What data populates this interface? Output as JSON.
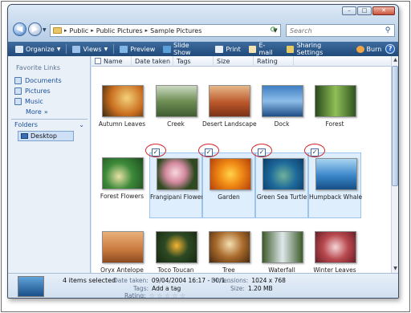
{
  "window": {
    "controls": {
      "minimize": "–",
      "maximize": "□",
      "close": "✕"
    }
  },
  "address": {
    "segments": [
      "Public",
      "Public Pictures",
      "Sample Pictures"
    ]
  },
  "search": {
    "placeholder": "Search"
  },
  "toolbar": {
    "organize": "Organize",
    "views": "Views",
    "preview": "Preview",
    "slideshow": "Slide Show",
    "print": "Print",
    "email": "E-mail",
    "sharing": "Sharing Settings",
    "burn": "Burn",
    "help": "?"
  },
  "nav": {
    "favorites_title": "Favorite Links",
    "favorites": [
      "Documents",
      "Pictures",
      "Music"
    ],
    "more": "More",
    "more_glyph": "»",
    "folders": "Folders",
    "desktop": "Desktop"
  },
  "columns": [
    "Name",
    "Date taken",
    "Tags",
    "Size",
    "Rating"
  ],
  "checkmark": "✓",
  "items": [
    {
      "name": "Autumn Leaves",
      "selected": false
    },
    {
      "name": "Creek",
      "selected": false
    },
    {
      "name": "Desert Landscape",
      "selected": false
    },
    {
      "name": "Dock",
      "selected": false
    },
    {
      "name": "Forest",
      "selected": false
    },
    {
      "name": "Forest Flowers",
      "selected": false
    },
    {
      "name": "Frangipani Flowers",
      "selected": true
    },
    {
      "name": "Garden",
      "selected": true
    },
    {
      "name": "Green Sea Turtle",
      "selected": true
    },
    {
      "name": "Humpback Whale",
      "selected": true
    },
    {
      "name": "Oryx Antelope",
      "selected": false
    },
    {
      "name": "Toco Toucan",
      "selected": false
    },
    {
      "name": "Tree",
      "selected": false
    },
    {
      "name": "Waterfall",
      "selected": false
    },
    {
      "name": "Winter Leaves",
      "selected": false
    }
  ],
  "details": {
    "summary": "4 items selected",
    "date_label": "Date taken:",
    "date_value": "09/04/2004 16:17 - 30/1...",
    "tags_label": "Tags:",
    "tags_value": "Add a tag",
    "rating_label": "Rating:",
    "dimensions_label": "Dimensions:",
    "dimensions_value": "1024 x 768",
    "size_label": "Size:",
    "size_value": "1.20 MB",
    "star": "☆"
  }
}
